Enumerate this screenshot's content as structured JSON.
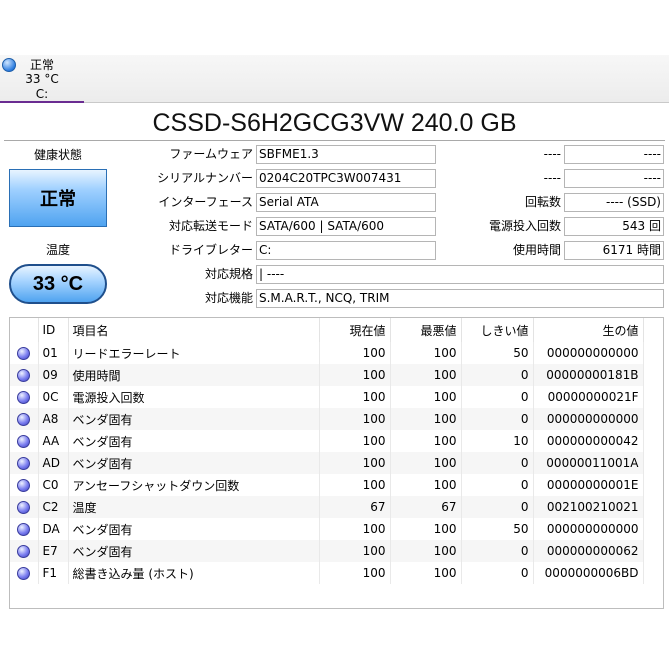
{
  "disk_tab": {
    "status": "正常",
    "temperature": "33 °C",
    "drive": "C:"
  },
  "model_title": "CSSD-S6H2GCG3VW 240.0 GB",
  "health": {
    "label": "健康状態",
    "value": "正常"
  },
  "temperature": {
    "label": "温度",
    "value": "33 °C"
  },
  "info": {
    "firmware": {
      "label": "ファームウェア",
      "value": "SBFME1.3"
    },
    "serial": {
      "label": "シリアルナンバー",
      "value": "0204C20TPC3W007431"
    },
    "interface": {
      "label": "インターフェース",
      "value": "Serial ATA"
    },
    "transfer_mode": {
      "label": "対応転送モード",
      "value": "SATA/600 | SATA/600"
    },
    "drive_letter": {
      "label": "ドライブレター",
      "value": "C:"
    },
    "standard": {
      "label": "対応規格",
      "value": "| ----"
    },
    "features": {
      "label": "対応機能",
      "value": "S.M.A.R.T., NCQ, TRIM"
    }
  },
  "right_info": {
    "blank1": {
      "label": "----",
      "value": "----"
    },
    "blank2": {
      "label": "----",
      "value": "----"
    },
    "rotation": {
      "label": "回転数",
      "value": "---- (SSD)"
    },
    "power_on_count": {
      "label": "電源投入回数",
      "value": "543 回"
    },
    "power_on_hours": {
      "label": "使用時間",
      "value": "6171 時間"
    }
  },
  "smart": {
    "headers": {
      "id": "ID",
      "name": "項目名",
      "current": "現在値",
      "worst": "最悪値",
      "threshold": "しきい値",
      "raw": "生の値"
    },
    "rows": [
      {
        "id": "01",
        "name": "リードエラーレート",
        "current": "100",
        "worst": "100",
        "threshold": "50",
        "raw": "000000000000"
      },
      {
        "id": "09",
        "name": "使用時間",
        "current": "100",
        "worst": "100",
        "threshold": "0",
        "raw": "00000000181B"
      },
      {
        "id": "0C",
        "name": "電源投入回数",
        "current": "100",
        "worst": "100",
        "threshold": "0",
        "raw": "00000000021F"
      },
      {
        "id": "A8",
        "name": "ベンダ固有",
        "current": "100",
        "worst": "100",
        "threshold": "0",
        "raw": "000000000000"
      },
      {
        "id": "AA",
        "name": "ベンダ固有",
        "current": "100",
        "worst": "100",
        "threshold": "10",
        "raw": "000000000042"
      },
      {
        "id": "AD",
        "name": "ベンダ固有",
        "current": "100",
        "worst": "100",
        "threshold": "0",
        "raw": "00000011001A"
      },
      {
        "id": "C0",
        "name": "アンセーフシャットダウン回数",
        "current": "100",
        "worst": "100",
        "threshold": "0",
        "raw": "00000000001E"
      },
      {
        "id": "C2",
        "name": "温度",
        "current": "67",
        "worst": "67",
        "threshold": "0",
        "raw": "002100210021"
      },
      {
        "id": "DA",
        "name": "ベンダ固有",
        "current": "100",
        "worst": "100",
        "threshold": "50",
        "raw": "000000000000"
      },
      {
        "id": "E7",
        "name": "ベンダ固有",
        "current": "100",
        "worst": "100",
        "threshold": "0",
        "raw": "000000000062"
      },
      {
        "id": "F1",
        "name": "総書き込み量 (ホスト)",
        "current": "100",
        "worst": "100",
        "threshold": "0",
        "raw": "0000000006BD"
      }
    ]
  },
  "colors": {
    "tab_underline": "#6a2c91",
    "health_blue": "#4fa3f0",
    "status_dot": "#5a5de0"
  }
}
